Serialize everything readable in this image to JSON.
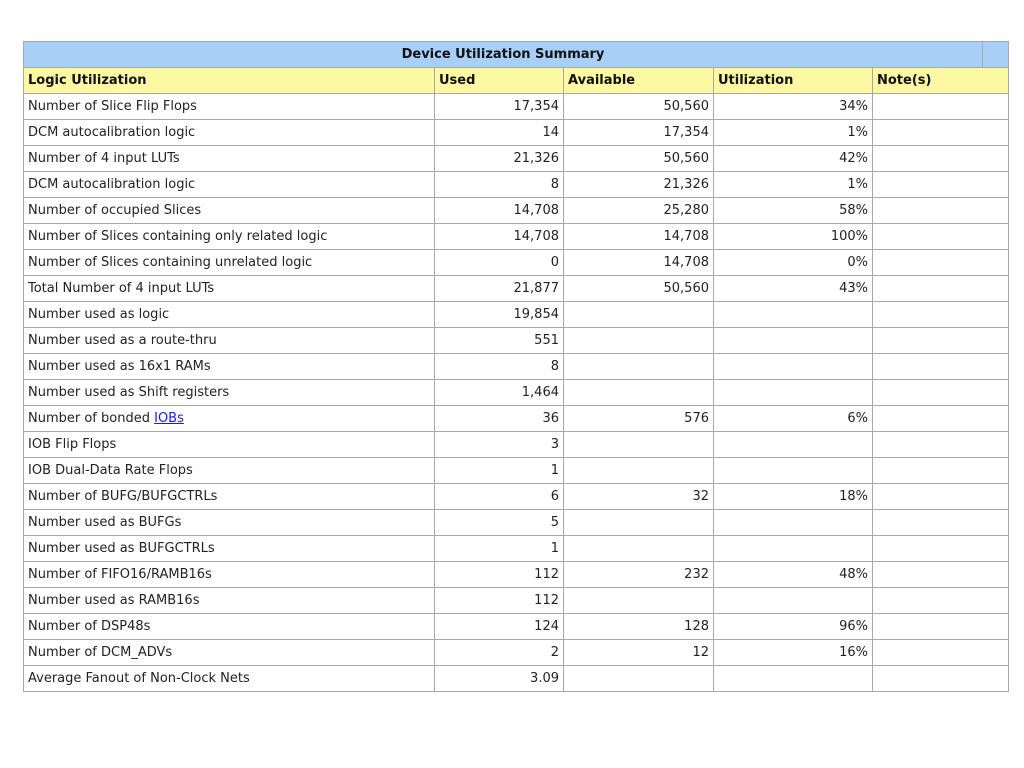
{
  "table": {
    "title": "Device Utilization Summary",
    "headers": {
      "logic": "Logic Utilization",
      "used": "Used",
      "available": "Available",
      "utilization": "Utilization",
      "notes": "Note(s)"
    },
    "rows": [
      {
        "label": "Number of Slice Flip Flops",
        "indent": false,
        "used": "17,354",
        "available": "50,560",
        "utilization": "34%",
        "notes": ""
      },
      {
        "label": "DCM autocalibration logic",
        "indent": true,
        "used": "14",
        "available": "17,354",
        "utilization": "1%",
        "notes": ""
      },
      {
        "label": "Number of 4 input LUTs",
        "indent": false,
        "used": "21,326",
        "available": "50,560",
        "utilization": "42%",
        "notes": ""
      },
      {
        "label": "DCM autocalibration logic",
        "indent": true,
        "used": "8",
        "available": "21,326",
        "utilization": "1%",
        "notes": ""
      },
      {
        "label": "Number of occupied Slices",
        "indent": false,
        "used": "14,708",
        "available": "25,280",
        "utilization": "58%",
        "notes": ""
      },
      {
        "label": "Number of Slices containing only related logic",
        "indent": true,
        "used": "14,708",
        "available": "14,708",
        "utilization": "100%",
        "notes": ""
      },
      {
        "label": "Number of Slices containing unrelated logic",
        "indent": true,
        "used": "0",
        "available": "14,708",
        "utilization": "0%",
        "notes": ""
      },
      {
        "label": "Total Number of 4 input LUTs",
        "indent": false,
        "used": "21,877",
        "available": "50,560",
        "utilization": "43%",
        "notes": ""
      },
      {
        "label": "Number used as logic",
        "indent": true,
        "used": "19,854",
        "available": "",
        "utilization": "",
        "notes": ""
      },
      {
        "label": "Number used as a route-thru",
        "indent": true,
        "used": "551",
        "available": "",
        "utilization": "",
        "notes": ""
      },
      {
        "label": "Number used as 16x1 RAMs",
        "indent": true,
        "used": "8",
        "available": "",
        "utilization": "",
        "notes": ""
      },
      {
        "label": "Number used as Shift registers",
        "indent": true,
        "used": "1,464",
        "available": "",
        "utilization": "",
        "notes": ""
      },
      {
        "label": "Number of bonded ",
        "link": "IOBs",
        "indent": false,
        "used": "36",
        "available": "576",
        "utilization": "6%",
        "notes": ""
      },
      {
        "label": "IOB Flip Flops",
        "indent": true,
        "used": "3",
        "available": "",
        "utilization": "",
        "notes": ""
      },
      {
        "label": "IOB Dual-Data Rate Flops",
        "indent": true,
        "used": "1",
        "available": "",
        "utilization": "",
        "notes": ""
      },
      {
        "label": "Number of BUFG/BUFGCTRLs",
        "indent": false,
        "used": "6",
        "available": "32",
        "utilization": "18%",
        "notes": ""
      },
      {
        "label": "Number used as BUFGs",
        "indent": true,
        "used": "5",
        "available": "",
        "utilization": "",
        "notes": ""
      },
      {
        "label": "Number used as BUFGCTRLs",
        "indent": true,
        "used": "1",
        "available": "",
        "utilization": "",
        "notes": ""
      },
      {
        "label": "Number of FIFO16/RAMB16s",
        "indent": false,
        "used": "112",
        "available": "232",
        "utilization": "48%",
        "notes": ""
      },
      {
        "label": "Number used as RAMB16s",
        "indent": true,
        "used": "112",
        "available": "",
        "utilization": "",
        "notes": ""
      },
      {
        "label": "Number of DSP48s",
        "indent": false,
        "used": "124",
        "available": "128",
        "utilization": "96%",
        "notes": ""
      },
      {
        "label": "Number of DCM_ADVs",
        "indent": false,
        "used": "2",
        "available": "12",
        "utilization": "16%",
        "notes": ""
      },
      {
        "label": "Average Fanout of Non-Clock Nets",
        "indent": false,
        "used": "3.09",
        "available": "",
        "utilization": "",
        "notes": ""
      }
    ]
  },
  "colors": {
    "title_bg": "#a7cff7",
    "header_bg": "#fdf9a3",
    "border": "#a8a8a8",
    "link": "#1a1aee"
  }
}
